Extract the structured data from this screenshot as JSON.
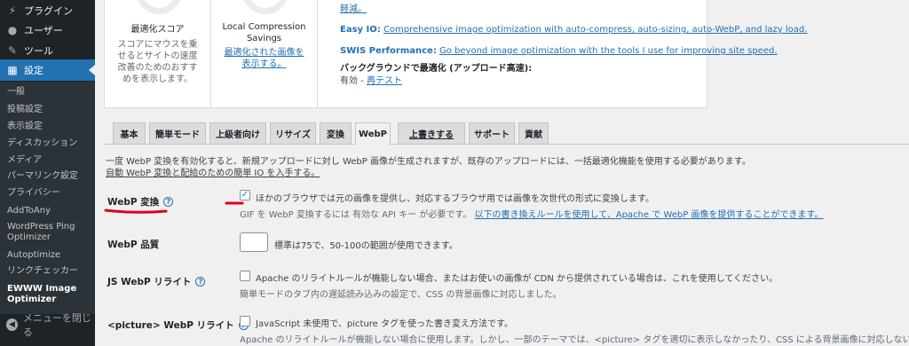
{
  "sidebar": {
    "menu": [
      {
        "label": "プラグイン",
        "icon": "plugin-icon"
      },
      {
        "label": "ユーザー",
        "icon": "users-icon"
      },
      {
        "label": "ツール",
        "icon": "tools-icon"
      },
      {
        "label": "設定",
        "icon": "settings-icon"
      }
    ],
    "submenu": [
      "一般",
      "投稿設定",
      "表示設定",
      "ディスカッション",
      "メディア",
      "パーマリンク設定",
      "プライバシー",
      "AddToAny",
      "WordPress Ping",
      "Optimizer",
      "Autoptimize",
      "リンクチェッカー",
      "EWWW Image",
      "Optimizer"
    ],
    "collapse": "メニューを閉じる"
  },
  "stats": {
    "score_title": "最適化スコア",
    "score_desc": [
      "スコアにマウスを乗",
      "せるとサイトの速度",
      "改善のためのおすす",
      "めを表示します。"
    ],
    "compression_title": [
      "Local Compression",
      "Savings"
    ],
    "compression_link": [
      "最適化された画像を",
      "表示する。"
    ]
  },
  "promos": {
    "top_link": "軽減。",
    "easyio_label": "Easy IO:",
    "easyio_text": "Comprehensive image optimization with auto-compress, auto-sizing, auto-WebP, and lazy load.",
    "swis_label": "SWIS Performance:",
    "swis_text": "Go beyond image optimization with the tools I use for improving site speed.",
    "bg_title": "バックグラウンドで最適化 (アップロード高速):",
    "bg_status": "有効 - ",
    "bg_retest": "再テスト"
  },
  "tabs": [
    "基本",
    "簡単モード",
    "上級者向け",
    "リサイズ",
    "変換",
    "WebP",
    "上書きする",
    "サポート",
    "貢献"
  ],
  "webp": {
    "intro1": "一度 WebP 変換を有効化すると、新規アップロードに対し WebP 画像が生成されますが、既存のアップロードには、一括最適化機能を使用する必要があります。",
    "intro2": "自動 WebP 変換と配給のための簡単 IO を入手する。",
    "conversion_label": "WebP 変換",
    "conversion_text": "ほかのブラウザでは元の画像を提供し、対応するブラウザ用では画像を次世代の形式に変換します。",
    "conversion_desc": "GIF を WebP 変換するには 有効な API キー が必要です。",
    "conversion_link": "以下の書き換えルールを使用して、Apache で WebP 画像を提供することができます。",
    "quality_label": "WebP 品質",
    "quality_desc": "標準は75で、50-100の範囲が使用できます。",
    "js_label": "JS WebP リライト",
    "js_text": "Apache のリライトルールが機能しない場合、またはお使いの画像が CDN から提供されている場合は、これを使用してください。",
    "js_desc": "簡単モードのタブ内の遅延読み込みの設定で、CSS の背景画像に対応しました。",
    "picture_label": "<picture> WebP リライト",
    "picture_text": "JavaScript 未使用で、picture タグを使った書き変え方法です。",
    "picture_desc": "Apache のリライトルールが機能しない場合に使用します。しかし、一部のテーマでは、<picture> タグを適切に表示しなかったり、CSS による背景画像に対応しないことがあります。",
    "help": "?",
    "checkmark": "✓"
  },
  "colors": {
    "accent": "#2271b1",
    "annotation": "#e0001a",
    "sidebar": "#1d2327"
  }
}
